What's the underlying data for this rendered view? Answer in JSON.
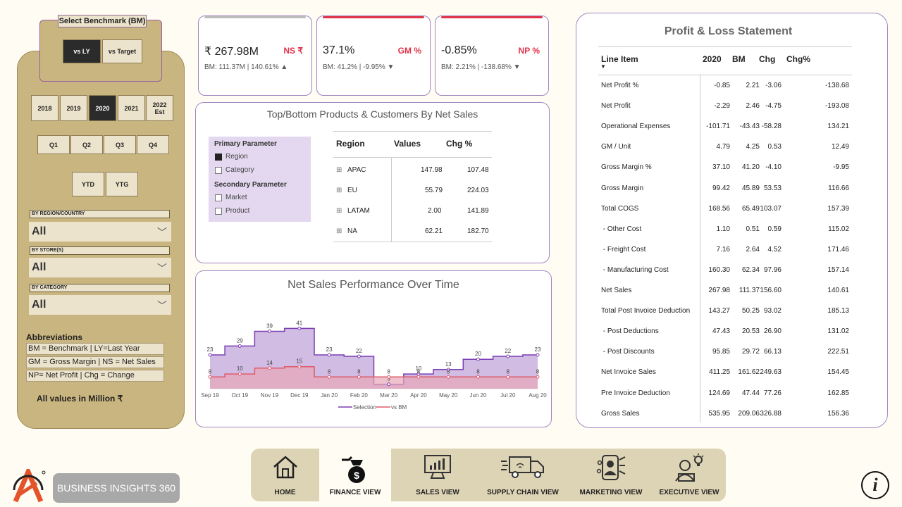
{
  "benchmark": {
    "title": "Select Benchmark (BM)",
    "options": [
      "vs LY",
      "vs Target"
    ],
    "selected": "vs LY"
  },
  "years": {
    "options": [
      "2018",
      "2019",
      "2020",
      "2021",
      "2022\nEst"
    ],
    "selected": "2020"
  },
  "quarters": [
    "Q1",
    "Q2",
    "Q3",
    "Q4"
  ],
  "ytd": [
    "YTD",
    "YTG"
  ],
  "filters": [
    {
      "label": "BY REGION/COUNTRY",
      "value": "All"
    },
    {
      "label": "BY STORE(S)",
      "value": "All"
    },
    {
      "label": "BY CATEGORY",
      "value": "All"
    }
  ],
  "abbreviations": {
    "title": "Abbreviations",
    "items": [
      "BM = Benchmark | LY=Last Year",
      "GM = Gross Margin | NS = Net Sales",
      "NP= Net Profit | Chg = Change"
    ]
  },
  "units_note": "All values in Million ₹",
  "kpis": [
    {
      "value": "₹ 267.98M",
      "label": "NS ₹",
      "sub": "BM: 111.37M | 140.61% ▲",
      "bar_color": "#bdbdbd"
    },
    {
      "value": "37.1%",
      "label": "GM %",
      "sub": "BM: 41.2% | -9.95% ▼",
      "bar_color": "#e0334a"
    },
    {
      "value": "-0.85%",
      "label": "NP %",
      "sub": "BM: 2.21% | -138.68% ▼",
      "bar_color": "#e0334a"
    }
  ],
  "top_bottom": {
    "title": "Top/Bottom Products & Customers By Net Sales",
    "primary_title": "Primary Parameter",
    "primary_options": [
      {
        "label": "Region",
        "checked": true
      },
      {
        "label": "Category",
        "checked": false
      }
    ],
    "secondary_title": "Secondary Parameter",
    "secondary_options": [
      {
        "label": "Market",
        "checked": false
      },
      {
        "label": "Product",
        "checked": false
      }
    ],
    "headers": [
      "Region",
      "Values",
      "Chg %"
    ],
    "rows": [
      {
        "region": "APAC",
        "value": "147.98",
        "chg": "107.48"
      },
      {
        "region": "EU",
        "value": "55.79",
        "chg": "224.03"
      },
      {
        "region": "LATAM",
        "value": "2.00",
        "chg": "141.89"
      },
      {
        "region": "NA",
        "value": "62.21",
        "chg": "182.70"
      }
    ]
  },
  "chart_data": {
    "type": "area",
    "title": "Net Sales Performance Over Time",
    "categories": [
      "Sep 19",
      "Oct 19",
      "Nov 19",
      "Dec 19",
      "Jan 20",
      "Feb 20",
      "Mar 20",
      "Apr 20",
      "May 20",
      "Jun 20",
      "Jul 20",
      "Aug 20"
    ],
    "series": [
      {
        "name": "Selection",
        "color": "#7b3fb3",
        "values": [
          23,
          29,
          39,
          41,
          23,
          22,
          3,
          10,
          13,
          20,
          22,
          23
        ]
      },
      {
        "name": "vs BM",
        "color": "#e05a6a",
        "values": [
          8,
          10,
          14,
          15,
          8,
          8,
          8,
          8,
          8,
          8,
          8,
          8
        ]
      }
    ],
    "ylim": [
      0,
      45
    ],
    "legend": "bottom"
  },
  "pl": {
    "title": "Profit & Loss Statement",
    "headers": [
      "Line Item",
      "2020",
      "BM",
      "Chg",
      "Chg%"
    ],
    "rows": [
      [
        "Net Profit %",
        "-0.85",
        "2.21",
        "-3.06",
        "-138.68"
      ],
      [
        "Net Profit",
        "-2.29",
        "2.46",
        "-4.75",
        "-193.08"
      ],
      [
        "Operational Expenses",
        "-101.71",
        "-43.43",
        "-58.28",
        "134.21"
      ],
      [
        "GM / Unit",
        "4.79",
        "4.25",
        "0.53",
        "12.49"
      ],
      [
        "Gross Margin %",
        "37.10",
        "41.20",
        "-4.10",
        "-9.95"
      ],
      [
        "Gross Margin",
        "99.42",
        "45.89",
        "53.53",
        "116.66"
      ],
      [
        "Total COGS",
        "168.56",
        "65.49",
        "103.07",
        "157.39"
      ],
      [
        " - Other Cost",
        "1.10",
        "0.51",
        "0.59",
        "115.02"
      ],
      [
        " - Freight Cost",
        "7.16",
        "2.64",
        "4.52",
        "171.46"
      ],
      [
        " - Manufacturing Cost",
        "160.30",
        "62.34",
        "97.96",
        "157.14"
      ],
      [
        "Net Sales",
        "267.98",
        "111.37",
        "156.60",
        "140.61"
      ],
      [
        "Total Post Invoice Deduction",
        "143.27",
        "50.25",
        "93.02",
        "185.13"
      ],
      [
        " - Post Deductions",
        "47.43",
        "20.53",
        "26.90",
        "131.02"
      ],
      [
        " - Post Discounts",
        "95.85",
        "29.72",
        "66.13",
        "222.51"
      ],
      [
        "Net Invoice Sales",
        "411.25",
        "161.62",
        "249.63",
        "154.45"
      ],
      [
        "Pre Invoice Deduction",
        "124.69",
        "47.44",
        "77.26",
        "162.85"
      ],
      [
        "Gross Sales",
        "535.95",
        "209.06",
        "326.88",
        "156.36"
      ]
    ]
  },
  "nav": {
    "items": [
      "HOME",
      "FINANCE VIEW",
      "SALES VIEW",
      "SUPPLY CHAIN VIEW",
      "MARKETING VIEW",
      "EXECUTIVE VIEW"
    ],
    "active": "FINANCE VIEW"
  },
  "brand": "BUSINESS INSIGHTS 360",
  "info_icon": "i"
}
